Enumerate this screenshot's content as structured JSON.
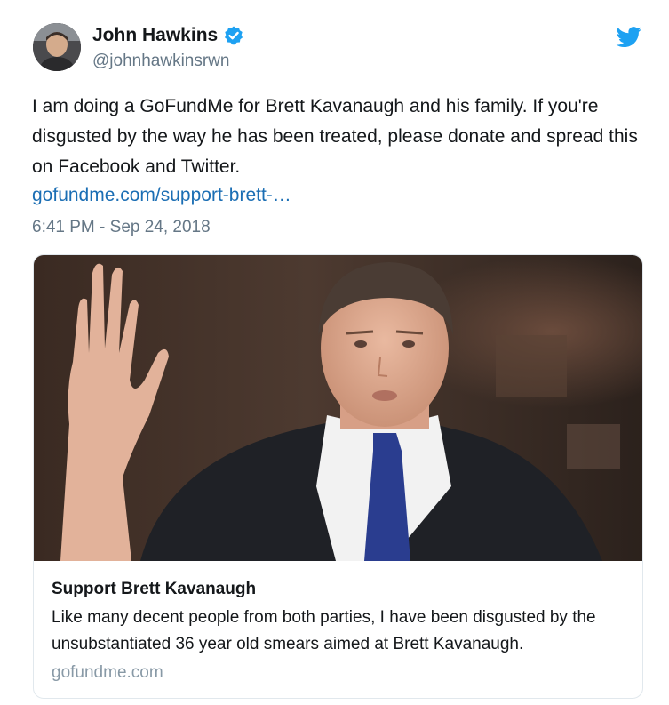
{
  "user": {
    "display_name": "John Hawkins",
    "handle": "@johnhawkinsrwn",
    "verified": true
  },
  "tweet": {
    "text": "I am doing a GoFundMe for Brett Kavanaugh and his family. If you're disgusted by the way he has been treated, please donate and spread this on Facebook and Twitter.",
    "link_text": "gofundme.com/support-brett-…",
    "timestamp": "6:41 PM - Sep 24, 2018"
  },
  "card": {
    "title": "Support Brett Kavanaugh",
    "description": "Like many decent people from both parties, I have been disgusted by the unsubstantiated 36 year old smears aimed at Brett Kavanaugh.",
    "domain": "gofundme.com"
  },
  "icons": {
    "verified": "verified-badge-icon",
    "brand": "twitter-bird-icon"
  },
  "colors": {
    "accent": "#1da1f2",
    "link": "#1b6eb4",
    "secondary_text": "#657786",
    "border": "#e1e8ed"
  }
}
